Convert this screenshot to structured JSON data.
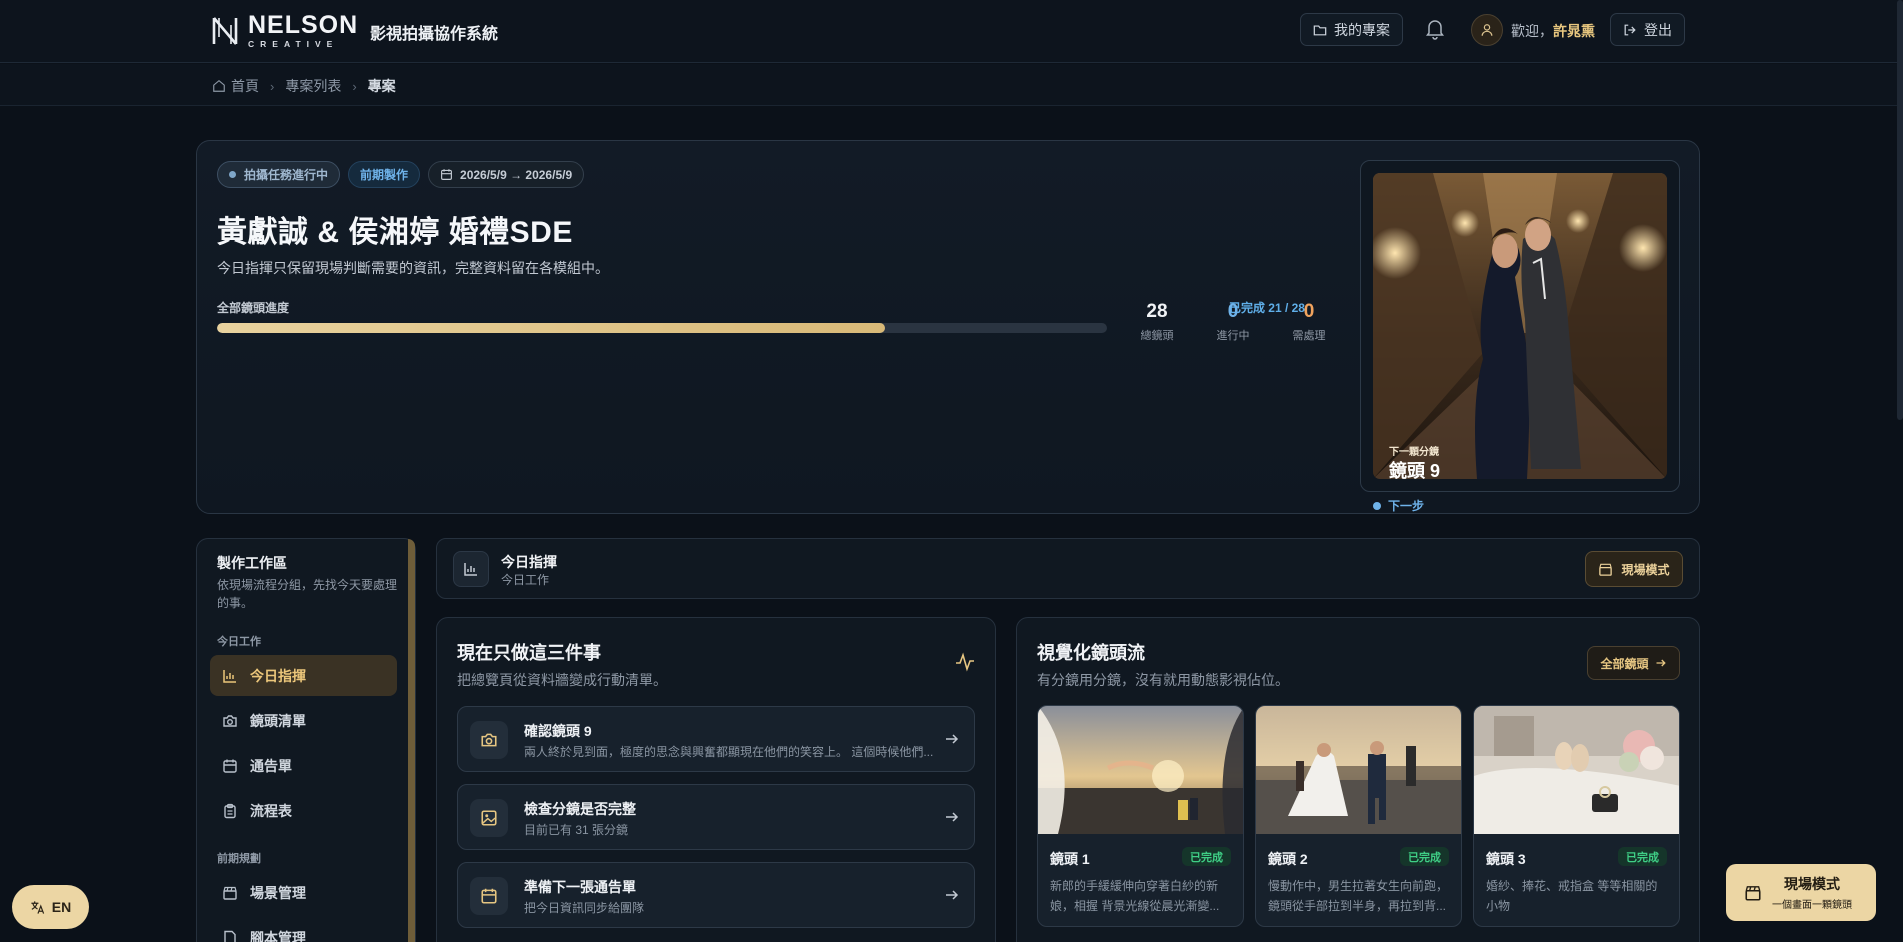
{
  "brand": {
    "name": "NELSON",
    "sub": "CREATIVE",
    "system": "影視拍攝協作系統"
  },
  "header": {
    "projects_label": "我的專案",
    "welcome_prefix": "歡迎，",
    "user_name": "許晁熏",
    "logout_label": "登出"
  },
  "breadcrumb": [
    "首頁",
    "專案列表",
    "專案"
  ],
  "hero": {
    "status": "拍攝任務進行中",
    "stage": "前期製作",
    "date_range": "2026/5/9 → 2026/5/9",
    "title": "黃獻誠 & 侯湘婷 婚禮SDE",
    "description": "今日指揮只保留現場判斷需要的資訊，完整資料留在各模組中。",
    "progress_label": "全部鏡頭進度",
    "progress_text": "已完成 21 / 28",
    "progress_fraction": 0.75,
    "stats": [
      {
        "value": "28",
        "label": "總鏡頭",
        "color": "#f1f3f6"
      },
      {
        "value": "0",
        "label": "進行中",
        "color": "#6fb3ea"
      },
      {
        "value": "0",
        "label": "需處理",
        "color": "#f0a35e"
      }
    ],
    "next_label": "下一顆分鏡",
    "next_shot": "鏡頭 9",
    "next_step": "下一步"
  },
  "sidebar": {
    "title": "製作工作區",
    "description": "依現場流程分組，先找今天要處理的事。",
    "groups": [
      {
        "label": "今日工作",
        "items": [
          {
            "label": "今日指揮",
            "icon": "bar-chart-icon",
            "active": true
          },
          {
            "label": "鏡頭清單",
            "icon": "camera-icon",
            "active": false
          },
          {
            "label": "通告單",
            "icon": "calendar-icon",
            "active": false
          },
          {
            "label": "流程表",
            "icon": "clipboard-icon",
            "active": false
          }
        ]
      },
      {
        "label": "前期規劃",
        "items": [
          {
            "label": "場景管理",
            "icon": "clapper-icon",
            "active": false
          },
          {
            "label": "腳本管理",
            "icon": "document-icon",
            "active": false
          }
        ]
      }
    ]
  },
  "today": {
    "title": "今日指揮",
    "subtitle": "今日工作",
    "field_mode_label": "現場模式"
  },
  "tasks_panel": {
    "title": "現在只做這三件事",
    "subtitle": "把總覽頁從資料牆變成行動清單。",
    "tasks": [
      {
        "title": "確認鏡頭 9",
        "sub": "兩人終於見到面，極度的思念與興奮都顯現在他們的笑容上。 這個時候他們...",
        "icon": "camera-icon"
      },
      {
        "title": "檢查分鏡是否完整",
        "sub": "目前已有 31 張分鏡",
        "icon": "image-icon"
      },
      {
        "title": "準備下一張通告單",
        "sub": "把今日資訊同步給團隊",
        "icon": "calendar-icon"
      }
    ]
  },
  "shots_panel": {
    "title": "視覺化鏡頭流",
    "subtitle": "有分鏡用分鏡，沒有就用動態影視佔位。",
    "all_label": "全部鏡頭",
    "shots": [
      {
        "title": "鏡頭 1",
        "status": "已完成",
        "desc": "新郎的手緩緩伸向穿著白紗的新娘，相握 背景光線從晨光漸變..."
      },
      {
        "title": "鏡頭 2",
        "status": "已完成",
        "desc": "慢動作中，男生拉著女生向前跑，鏡頭從手部拉到半身，再拉到背..."
      },
      {
        "title": "鏡頭 3",
        "status": "已完成",
        "desc": "婚紗、捧花、戒指盒 等等相關的小物"
      }
    ]
  },
  "floating": {
    "lang_label": "EN",
    "field_title": "現場模式",
    "field_sub": "一個畫面一顆鏡頭"
  }
}
